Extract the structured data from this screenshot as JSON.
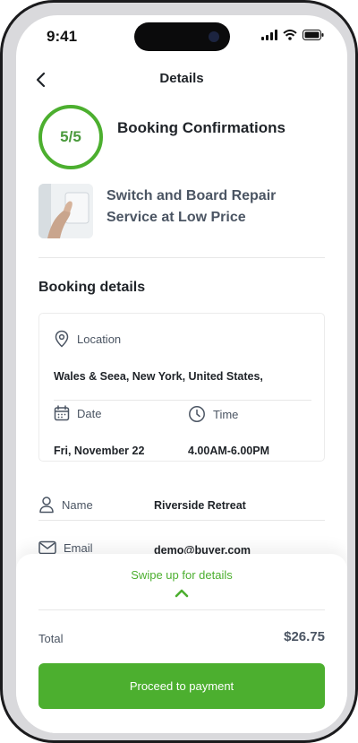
{
  "status_bar": {
    "time": "9:41"
  },
  "header": {
    "title": "Details",
    "back_icon": "chevron-left-icon"
  },
  "progress": {
    "label": "5/5",
    "current": 5,
    "total": 5,
    "heading": "Booking Confirmations",
    "color": "#4a9a3c"
  },
  "service": {
    "title": "Switch and Board Repair Service at Low Price"
  },
  "booking_details": {
    "section_title": "Booking details",
    "location_label": "Location",
    "location_value": "Wales & Seea, New York, United States,",
    "date_label": "Date",
    "date_value": "Fri, November 22",
    "time_label": "Time",
    "time_value": "4.00AM-6.00PM"
  },
  "contact": {
    "name_label": "Name",
    "name_value": "Riverside Retreat",
    "email_label": "Email",
    "email_value": "demo@buyer.com"
  },
  "sheet": {
    "swipe_text": "Swipe up for details",
    "total_label": "Total",
    "total_value": "$26.75",
    "button_label": "Proceed to payment"
  },
  "colors": {
    "accent": "#4caf2f",
    "text": "#1f2328",
    "muted": "#4b5563"
  }
}
